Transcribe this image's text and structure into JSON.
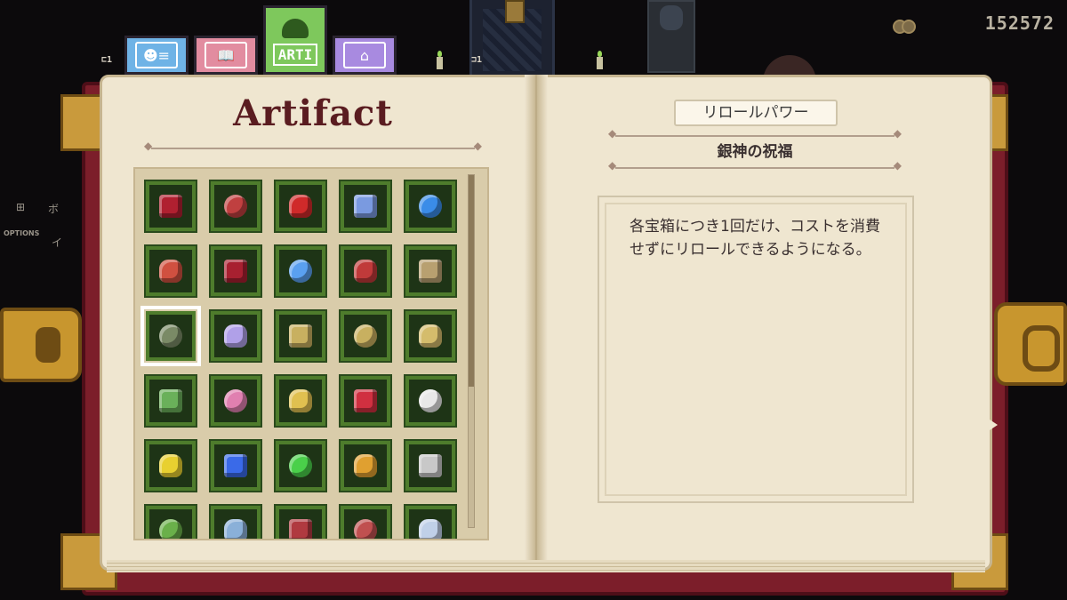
{
  "hud": {
    "coins": "152572",
    "side_labels": [
      "⊞",
      "ボ",
      "OPTIONS",
      "イ"
    ],
    "tab_hints": [
      "⊏1",
      "⊐1"
    ]
  },
  "tabs": [
    {
      "id": "character",
      "icon": "person-card-icon",
      "color": "#6fb3e6"
    },
    {
      "id": "tome",
      "icon": "open-book-icon",
      "color": "#e28ca0"
    },
    {
      "id": "arti",
      "label": "ARTI",
      "icon": "sprout-icon",
      "color": "#7ec85c",
      "active": true
    },
    {
      "id": "misc",
      "icon": "chest-icon",
      "color": "#a88ae0"
    }
  ],
  "left_page": {
    "title": "Artifact",
    "selected_index": 10,
    "scroll_fraction": 0.6,
    "artifacts": [
      {
        "icon": "red-dagger-icon",
        "color": "#b02030"
      },
      {
        "icon": "red-mask-icon",
        "color": "#c04040"
      },
      {
        "icon": "red-demon-icon",
        "color": "#d02a2a"
      },
      {
        "icon": "blue-syringe-icon",
        "color": "#7a9ae0"
      },
      {
        "icon": "blue-orb-icon",
        "color": "#3a8ce8"
      },
      {
        "icon": "red-shell-icon",
        "color": "#d05040"
      },
      {
        "icon": "red-rose-icon",
        "color": "#a82030"
      },
      {
        "icon": "blue-crystal-icon",
        "color": "#5aa0f0"
      },
      {
        "icon": "red-envelope-icon",
        "color": "#c03a3a"
      },
      {
        "icon": "tan-idol-icon",
        "color": "#b8a070"
      },
      {
        "icon": "stone-key-icon",
        "color": "#7a8a66"
      },
      {
        "icon": "fan-shell-icon",
        "color": "#b0a0e8"
      },
      {
        "icon": "gold-ring-icon",
        "color": "#c8b060"
      },
      {
        "icon": "gold-ring-stack-icon",
        "color": "#c8b060"
      },
      {
        "icon": "gold-ring-triple-icon",
        "color": "#d4bc6c"
      },
      {
        "icon": "green-syringe-icon",
        "color": "#6ab05a"
      },
      {
        "icon": "pink-syringe-icon",
        "color": "#e080b0"
      },
      {
        "icon": "yellow-syringe-icon",
        "color": "#e0c050"
      },
      {
        "icon": "red-heart-pendant-icon",
        "color": "#d03040"
      },
      {
        "icon": "white-heart-pendant-icon",
        "color": "#e8e8e8"
      },
      {
        "icon": "yellow-heart-pendant-icon",
        "color": "#e8d030"
      },
      {
        "icon": "blue-heart-pendant-icon",
        "color": "#3a6ae8"
      },
      {
        "icon": "green-heart-pendant-icon",
        "color": "#4ad04a"
      },
      {
        "icon": "gold-stopwatch-icon",
        "color": "#e0a030"
      },
      {
        "icon": "silver-stopwatch-icon",
        "color": "#c8c8c8"
      },
      {
        "icon": "frog-charm-icon",
        "color": "#6ab04a"
      },
      {
        "icon": "blue-ghost-charm-icon",
        "color": "#8ab0d8"
      },
      {
        "icon": "red-beetle-icon",
        "color": "#b03a40"
      },
      {
        "icon": "red-shell-creature-icon",
        "color": "#c05050"
      },
      {
        "icon": "white-orb-icon",
        "color": "#c0d0e8"
      }
    ]
  },
  "right_page": {
    "artifact_name": "リロールパワー",
    "subtitle": "銀神の祝福",
    "description": "各宝箱につき1回だけ、コストを消費せずにリロールできるようになる。"
  }
}
